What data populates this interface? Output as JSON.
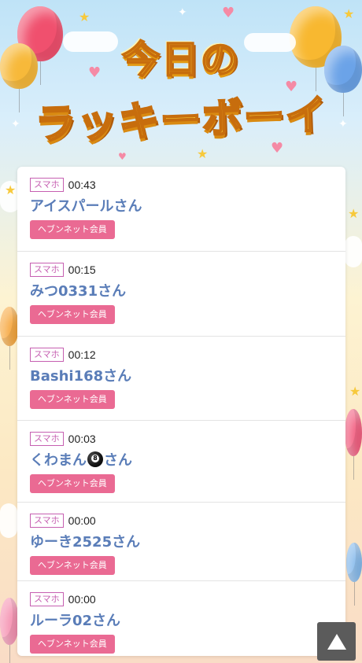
{
  "header": {
    "title_line1": "今日の",
    "title_line2": "ラッキーボーイ"
  },
  "entries": [
    {
      "device": "スマホ",
      "time": "00:43",
      "name": "アイスパールさん",
      "badge": "ヘブンネット会員"
    },
    {
      "device": "スマホ",
      "time": "00:15",
      "name": "みつ0331さん",
      "badge": "ヘブンネット会員"
    },
    {
      "device": "スマホ",
      "time": "00:12",
      "name": "Bashi168さん",
      "badge": "ヘブンネット会員"
    },
    {
      "device": "スマホ",
      "time": "00:03",
      "name_prefix": "くわまん",
      "name_suffix": "さん",
      "name_icon": "billiard-ball-icon",
      "badge": "ヘブンネット会員"
    },
    {
      "device": "スマホ",
      "time": "00:00",
      "name": "ゆーき2525さん",
      "badge": "ヘブンネット会員"
    },
    {
      "device": "スマホ",
      "time": "00:00",
      "name": "ルーラ02さん",
      "badge": "ヘブンネット会員"
    }
  ],
  "scroll_top": {
    "icon": "up-triangle-icon"
  },
  "colors": {
    "badge_pink": "#ea6a93",
    "device_purple": "#c65fb1",
    "name_blue": "#5a7db8",
    "title_yellow": "#ffd83a"
  }
}
